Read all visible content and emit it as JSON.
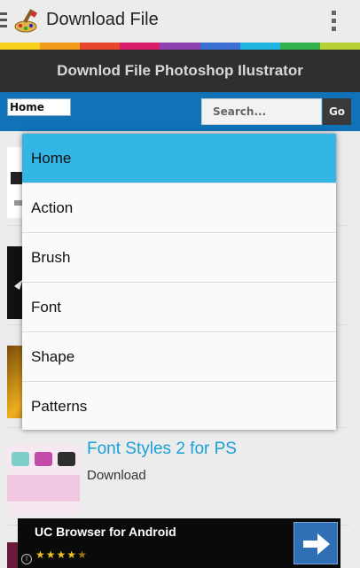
{
  "app": {
    "title": "Download File"
  },
  "header": {
    "title": "Downlod File Photoshop Ilustrator"
  },
  "nav": {
    "category_value": "Home",
    "search_placeholder": "Search...",
    "go_label": "Go"
  },
  "dropdown": {
    "selected_index": 0,
    "items": [
      "Home",
      "Action",
      "Brush",
      "Font",
      "Shape",
      "Patterns"
    ]
  },
  "list": {
    "visible_item": {
      "title": "Font Styles 2 for PS",
      "subtitle": "Download"
    }
  },
  "ad": {
    "title": "UC Browser for Android",
    "rating_stars": 4.5,
    "info_label": "i"
  },
  "colors": {
    "accent_blue": "#1172b8",
    "selection": "#33b5e5",
    "link": "#1aa0d8",
    "header_bg": "#2f2f2f",
    "stripe": [
      "#f7d21c",
      "#f59b1c",
      "#e8452c",
      "#d91f6b",
      "#8e3fb0",
      "#3b6fd1",
      "#1eb3e0",
      "#2fb24c",
      "#b6d233"
    ]
  },
  "icons": {
    "app": "paintbrush-palette-icon",
    "overflow": "more-vertical-icon",
    "drawer": "menu-icon",
    "ad_arrow": "arrow-right-icon",
    "ad_info": "info-icon"
  }
}
